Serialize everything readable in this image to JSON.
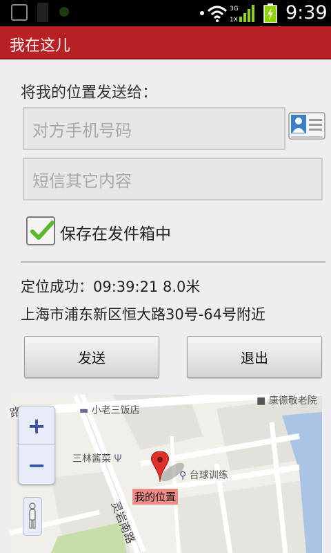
{
  "status_bar": {
    "time": "9:39",
    "network": "3G",
    "network_secondary": "1X"
  },
  "app": {
    "title": "我在这儿"
  },
  "form": {
    "send_to_label": "将我的位置发送给：",
    "phone_placeholder": "对方手机号码",
    "message_placeholder": "短信其它内容",
    "save_outbox_label": "保存在发件箱中",
    "save_outbox_checked": true
  },
  "location": {
    "status": "定位成功：09:39:21  8.0米",
    "address": "上海市浦东新区恒大路30号-64号附近"
  },
  "buttons": {
    "send": "发送",
    "exit": "退出"
  },
  "map": {
    "labels": {
      "restaurant1": "小老三饭店",
      "nursing_home": "康德敬老院",
      "restaurant2": "三林酱菜",
      "billiards": "台球训练",
      "road_bottom": "灵岩南路",
      "road_left": "路"
    },
    "my_position": "我的位置",
    "zoom_in": "+",
    "zoom_out": "−"
  },
  "colors": {
    "title_bar": "#b92023",
    "marker": "#e0302a",
    "my_position_bg": "#f08a86",
    "checkbox_check": "#5bb82a"
  },
  "icons": [
    "contact-card-icon",
    "checkmark-icon",
    "map-marker-icon",
    "restaurant-icon",
    "bed-icon",
    "billiards-icon",
    "pegman-icon",
    "wifi-icon",
    "signal-icon",
    "battery-icon"
  ]
}
